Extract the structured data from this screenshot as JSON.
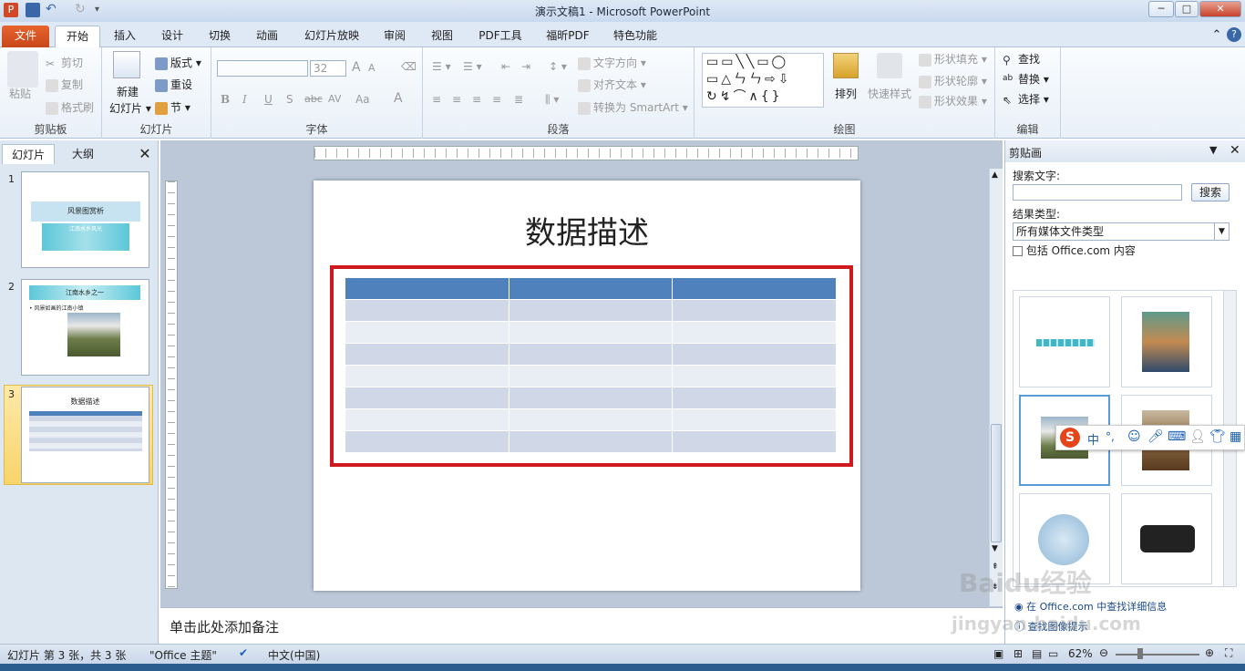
{
  "window": {
    "title": "演示文稿1 - Microsoft PowerPoint",
    "min": "─",
    "max": "□",
    "close": "✕"
  },
  "tabs": [
    "文件",
    "开始",
    "插入",
    "设计",
    "切换",
    "动画",
    "幻灯片放映",
    "审阅",
    "视图",
    "PDF工具",
    "福昕PDF",
    "特色功能"
  ],
  "ribbon": {
    "clipboard": {
      "label": "剪贴板",
      "paste": "粘贴",
      "cut": "剪切",
      "copy": "复制",
      "format_painter": "格式刷"
    },
    "slides": {
      "label": "幻灯片",
      "new_slide_1": "新建",
      "new_slide_2": "幻灯片",
      "layout": "版式",
      "reset": "重设",
      "section": "节"
    },
    "font": {
      "label": "字体",
      "size": "32",
      "bold": "B",
      "italic": "I",
      "underline": "U",
      "shadow": "S",
      "strike": "abc",
      "spacing": "AV",
      "case": "Aa",
      "color": "A",
      "grow": "A",
      "shrink": "A"
    },
    "paragraph": {
      "label": "段落",
      "text_direction": "文字方向",
      "align_text": "对齐文本",
      "smartart": "转换为 SmartArt"
    },
    "drawing": {
      "label": "绘图",
      "arrange": "排列",
      "quick_styles": "快速样式",
      "shape_fill": "形状填充",
      "shape_outline": "形状轮廓",
      "shape_effects": "形状效果"
    },
    "editing": {
      "label": "编辑",
      "find": "查找",
      "replace": "替换",
      "select": "选择"
    }
  },
  "left_panel": {
    "tab_slides": "幻灯片",
    "tab_outline": "大纲",
    "thumbs": [
      {
        "num": "1",
        "title": "风景图赏析",
        "subtitle": "江南水乡风光"
      },
      {
        "num": "2",
        "title": "江南水乡之一",
        "bullet": "• 风景如画的江南小镇"
      },
      {
        "num": "3",
        "title": "数据描述"
      }
    ]
  },
  "slide": {
    "title": "数据描述",
    "table_rows": 8,
    "table_cols": 3
  },
  "notes": {
    "placeholder": "单击此处添加备注"
  },
  "clip_art": {
    "title": "剪贴画",
    "search_label": "搜索文字:",
    "search_value": "",
    "search_button": "搜索",
    "result_type_label": "结果类型:",
    "result_type_value": "所有媒体文件类型",
    "include_office": "包括 Office.com 内容",
    "link_more": "在 Office.com 中查找详细信息",
    "link_tips": "查找图像提示"
  },
  "ime": {
    "logo": "S",
    "lang": "中",
    "punct": "°,"
  },
  "status": {
    "slide_info": "幻灯片 第 3 张，共 3 张",
    "theme": "\"Office 主题\"",
    "language": "中文(中国)",
    "zoom": "62%"
  },
  "watermark": {
    "line1": "Baidu经验",
    "line2": "jingyan.baidu.com"
  },
  "colors": {
    "accent": "#4f81bd",
    "file_tab": "#d9531e",
    "highlight": "#d0191f",
    "table_header": "#4f81bd",
    "row_dark": "#d0d8e8",
    "row_light": "#e9edf4"
  }
}
